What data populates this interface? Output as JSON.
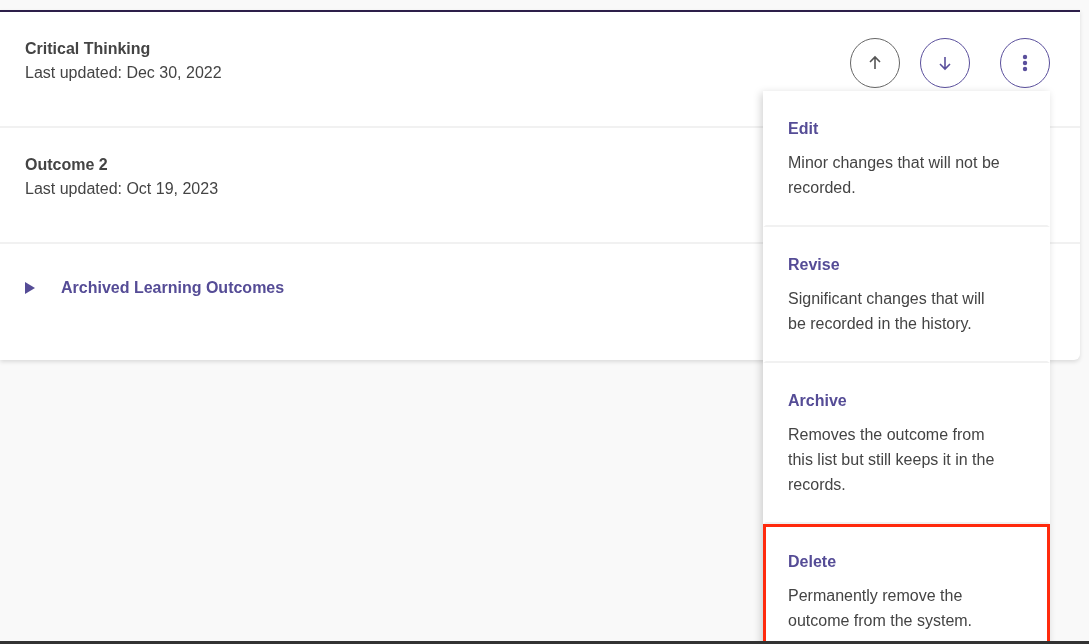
{
  "outcomes": [
    {
      "title": "Critical Thinking",
      "updated": "Last updated: Dec 30, 2022",
      "actions": [
        {
          "kind": "up",
          "disabled": true
        },
        {
          "kind": "down",
          "disabled": false
        },
        {
          "kind": "more",
          "disabled": false
        }
      ]
    },
    {
      "title": "Outcome 2",
      "updated": "Last updated: Oct 19, 2023"
    }
  ],
  "archived": {
    "label": "Archived Learning Outcomes",
    "expanded": false
  },
  "menu": [
    {
      "title": "Edit",
      "description": "Minor changes that will not be recorded.",
      "highlighted": false
    },
    {
      "title": "Revise",
      "description": "Significant changes that will be recorded in the history.",
      "highlighted": false
    },
    {
      "title": "Archive",
      "description": "Removes the outcome from this list but still keeps it in the records.",
      "highlighted": false
    },
    {
      "title": "Delete",
      "description": "Permanently remove the outcome from the system.",
      "highlighted": true
    }
  ]
}
